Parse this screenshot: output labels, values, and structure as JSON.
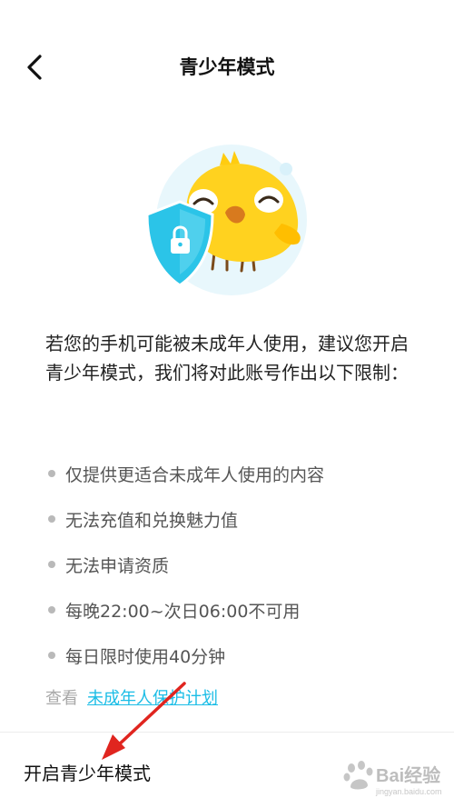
{
  "header": {
    "title": "青少年模式"
  },
  "intro": "若您的手机可能被未成年人使用，建议您开启青少年模式，我们将对此账号作出以下限制：",
  "restrictions": [
    "仅提供更适合未成年人使用的内容",
    "无法充值和兑换魅力值",
    "无法申请资质",
    "每晚22:00~次日06:00不可用",
    "每日限时使用40分钟"
  ],
  "view": {
    "prefix": "查看",
    "link": "未成年人保护计划"
  },
  "bottom": {
    "enable_label": "开启青少年模式"
  },
  "colors": {
    "link": "#1bbde6",
    "shield": "#2bc4e8",
    "bird": "#ffd21f"
  },
  "icons": {
    "back": "chevron-left-icon",
    "shield": "shield-lock-icon"
  }
}
